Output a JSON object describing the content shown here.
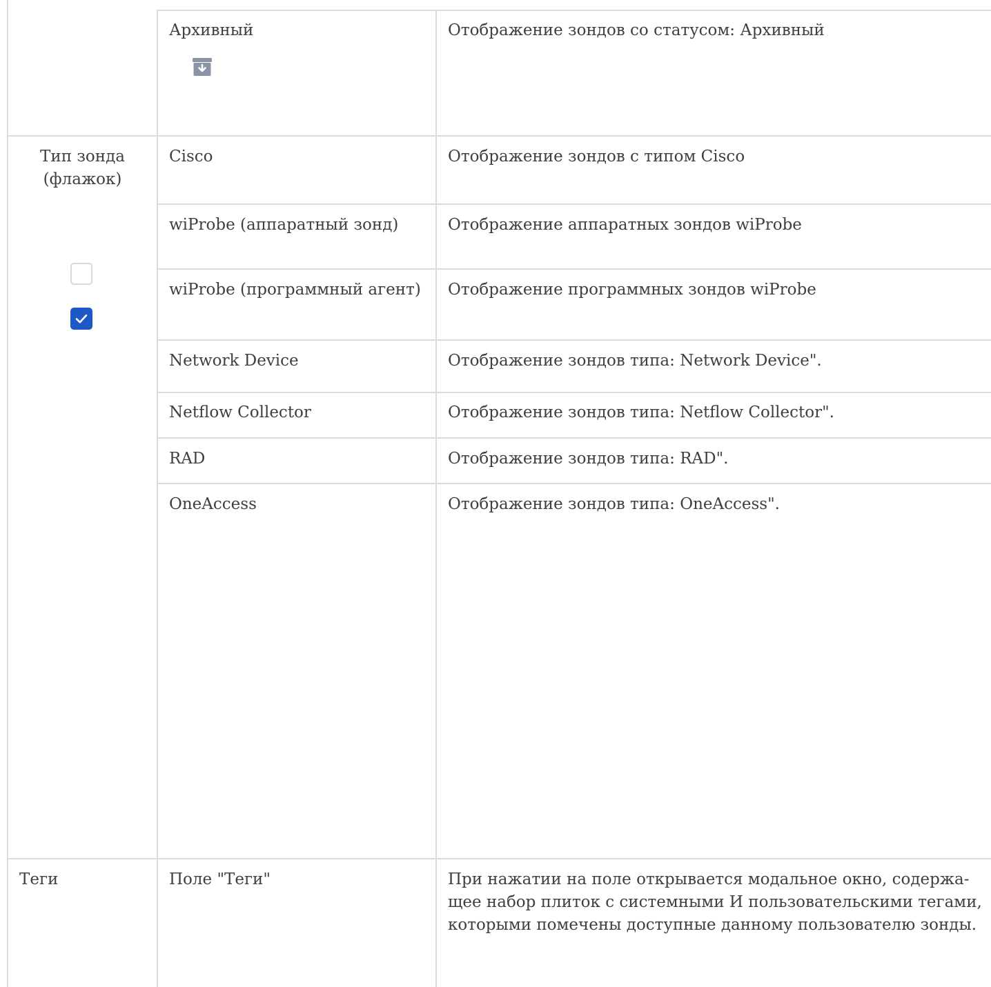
{
  "rows": {
    "archived": {
      "option": "Архивный",
      "description": "Отображение зондов со статусом: Архивный",
      "icon": "archive-icon"
    },
    "probe_type": {
      "label_line1": "Тип зонда",
      "label_line2": "(флажок)",
      "checkbox_unchecked_icon": "checkbox-unchecked-icon",
      "checkbox_checked_icon": "checkbox-checked-icon",
      "items": [
        {
          "option": "Cisco",
          "description": "Отображение зондов с типом Cisco"
        },
        {
          "option": "wiProbe (аппаратный зонд)",
          "description": "Отображение аппаратных зондов wiProbe"
        },
        {
          "option": "wiProbe (программный агент)",
          "description": "Отображение программных зондов wiProbe"
        },
        {
          "option": "Network Device",
          "description": "Отображение зондов типа: Network Device\"."
        },
        {
          "option": "Netflow Collector",
          "description": "Отображение зондов типа: Netflow Collector\"."
        },
        {
          "option": "RAD",
          "description": "Отображение зондов типа: RAD\"."
        },
        {
          "option": "OneAccess",
          "description": "Отображение зондов типа: OneAccess\"."
        }
      ]
    },
    "tags": {
      "label": "Теги",
      "option": "Поле \"Теги\"",
      "description_line1": "При нажатии на поле открывается модальное окно, содержа-",
      "description_line2": "щее набор плиток с системными И пользовательскими тегами,",
      "description_line3": "которыми помечены доступные данному пользователю зонды."
    }
  },
  "colors": {
    "border": "#dcdcdc",
    "text": "#3f3f3f",
    "checkbox_checked": "#1d58c7",
    "archive_icon": "#8a94a6"
  }
}
